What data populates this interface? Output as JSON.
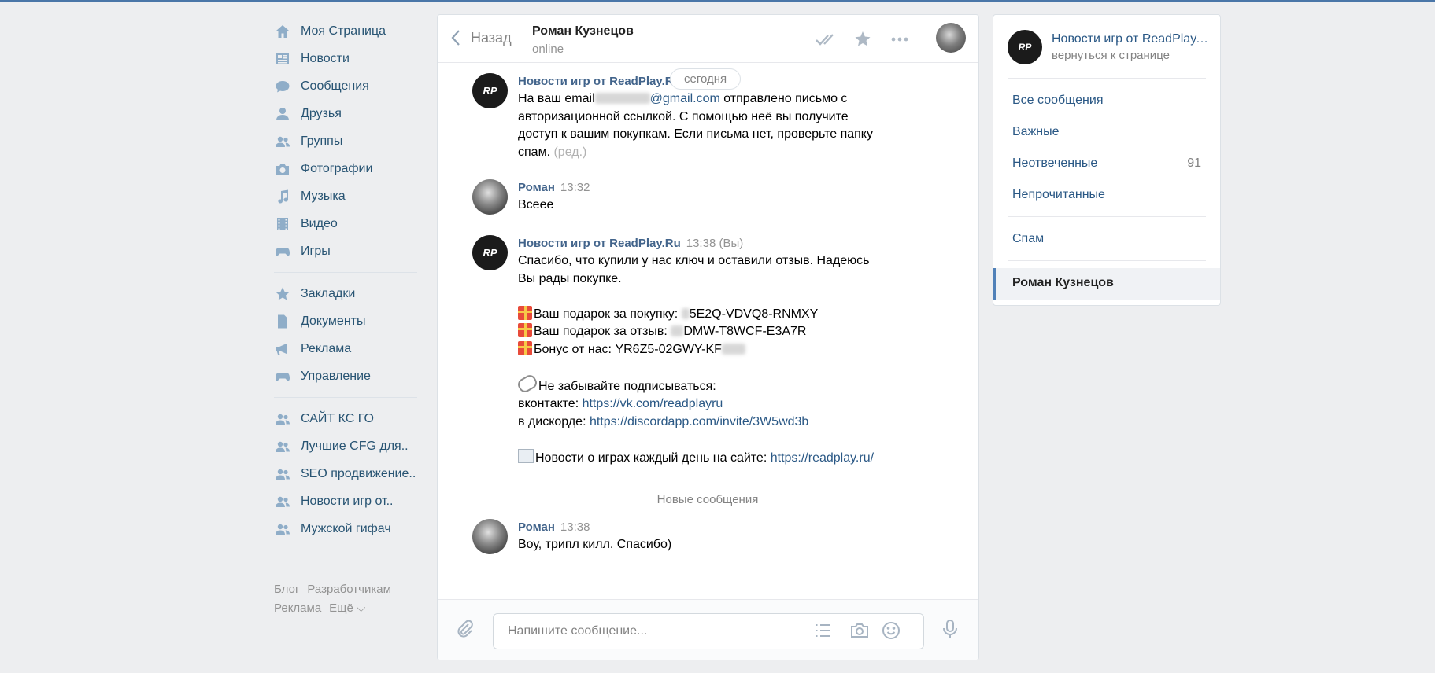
{
  "nav": {
    "items": [
      {
        "label": "Моя Страница",
        "icon": "home-icon"
      },
      {
        "label": "Новости",
        "icon": "news-icon"
      },
      {
        "label": "Сообщения",
        "icon": "messages-icon"
      },
      {
        "label": "Друзья",
        "icon": "friend-icon"
      },
      {
        "label": "Группы",
        "icon": "groups-icon"
      },
      {
        "label": "Фотографии",
        "icon": "camera-icon"
      },
      {
        "label": "Музыка",
        "icon": "music-icon"
      },
      {
        "label": "Видео",
        "icon": "video-icon"
      },
      {
        "label": "Игры",
        "icon": "gamepad-icon"
      }
    ],
    "items2": [
      {
        "label": "Закладки",
        "icon": "star-icon"
      },
      {
        "label": "Документы",
        "icon": "document-icon"
      },
      {
        "label": "Реклама",
        "icon": "megaphone-icon"
      },
      {
        "label": "Управление",
        "icon": "gamepad-icon"
      }
    ],
    "items3": [
      {
        "label": "САЙТ КС ГО",
        "icon": "groups-icon"
      },
      {
        "label": "Лучшие CFG для..",
        "icon": "groups-icon"
      },
      {
        "label": "SEO продвижение..",
        "icon": "groups-icon"
      },
      {
        "label": "Новости игр от..",
        "icon": "groups-icon"
      },
      {
        "label": "Мужской гифач",
        "icon": "groups-icon"
      }
    ],
    "footer": {
      "blog": "Блог",
      "dev": "Разработчикам",
      "ads": "Реклама",
      "more": "Ещё ⌵"
    }
  },
  "chat": {
    "back_label": "Назад",
    "peer_name": "Роман Кузнецов",
    "peer_status": "online",
    "date_pill": "сегодня",
    "msg1": {
      "author": "Новости игр от ReadPlay.R",
      "line1_a": "На ваш email",
      "line1_link": "@gmail.com",
      "line1_b": " отправлено письмо с",
      "line2": "авторизационной ссылкой. С помощью неё вы получите",
      "line3": "доступ к вашим покупкам. Если письма нет, проверьте папку",
      "line4": "спам.",
      "edited": "(ред.)"
    },
    "msg2": {
      "author": "Роман",
      "time": "13:32",
      "text": "Всеее"
    },
    "msg3": {
      "author": "Новости игр от ReadPlay.Ru",
      "time": "13:38 (Вы)",
      "line1": "Спасибо, что купили у нас ключ и оставили отзыв. Надеюсь",
      "line2": "Вы рады покупке.",
      "gift1": "Ваш подарок за покупку: ",
      "gift1_code": "5E2Q-VDVQ8-RNMXY",
      "gift2": "Ваш подарок за отзыв: ",
      "gift2_code": "DMW-T8WCF-E3A7R",
      "gift3": "Бонус от нас: YR6Z5-02GWY-KF",
      "subscribe": "Не забывайте подписываться:",
      "vk_label": "вконтакте: ",
      "vk_link": "https://vk.com/readplayru",
      "discord_label": "в дискорде: ",
      "discord_link": "https://discordapp.com/invite/3W5wd3b",
      "site_label": "Новости о играх каждый день на сайте: ",
      "site_link": "https://readplay.ru/"
    },
    "new_messages": "Новые сообщения",
    "msg4": {
      "author": "Роман",
      "time": "13:38",
      "text": "Воу, трипл килл. Спасибо)"
    },
    "composer_placeholder": "Напишите сообщение..."
  },
  "right": {
    "group_name": "Новости игр от ReadPlay.Ru",
    "group_back": "вернуться к странице",
    "all": "Все сообщения",
    "important": "Важные",
    "unanswered": "Неотвеченные",
    "unanswered_count": "91",
    "unread": "Непрочитанные",
    "spam": "Спам",
    "active": "Роман Кузнецов"
  },
  "avatar_text": "RP",
  "colors": {
    "link": "#2a5885",
    "author": "#42648b",
    "accent": "#5181b8",
    "bg": "#edeef0"
  }
}
